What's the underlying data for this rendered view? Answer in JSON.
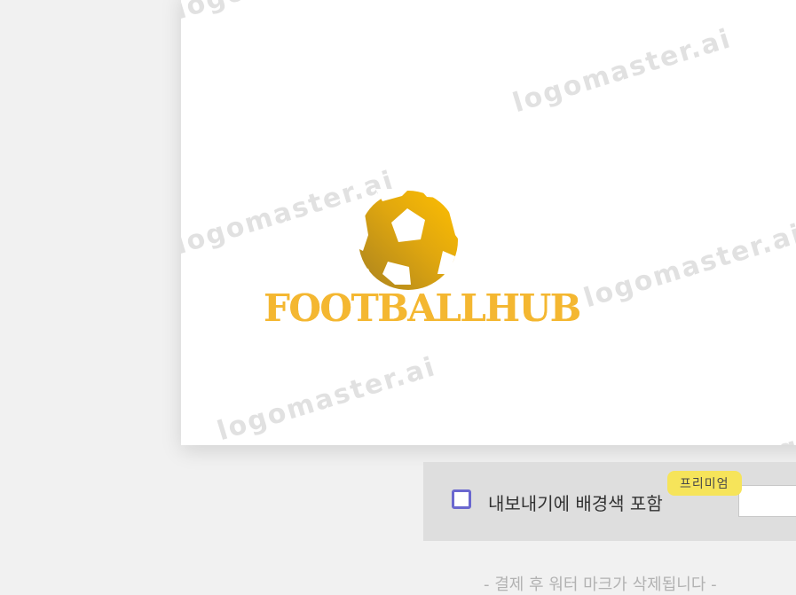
{
  "preview": {
    "watermark_text": "logomaster.ai",
    "logo": {
      "icon": "soccer-ball-icon",
      "name": "FOOTBALLHUB",
      "colors": {
        "primary": "#f4b731",
        "gradient_start": "#b8891a",
        "gradient_end": "#f9bc12"
      }
    }
  },
  "export_options": {
    "include_background_label": "내보내기에 배경색 포함",
    "include_background_checked": false,
    "premium_badge": "프리미엄",
    "accent_color": "#6a67cf",
    "badge_color": "#f6e45a"
  },
  "footer": {
    "note": "- 결제 후 워터 마크가 삭제됩니다 -"
  }
}
